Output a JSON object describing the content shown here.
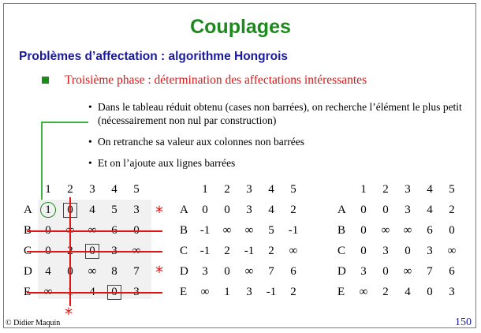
{
  "title": "Couplages",
  "subtitle": "Problèmes d’affectation : algorithme Hongrois",
  "phase": "Troisième phase : détermination des affectations intéressantes",
  "bullet_char": "•",
  "bullets": [
    "Dans le tableau réduit obtenu (cases non barrées), on recherche l’élément le plus petit (nécessairement non nul par construction)",
    "On retranche sa valeur aux colonnes non barrées",
    "Et on l’ajoute aux lignes barrées"
  ],
  "col_headers": [
    "1",
    "2",
    "3",
    "4",
    "5"
  ],
  "row_headers": [
    "A",
    "B",
    "C",
    "D",
    "E"
  ],
  "star": "*",
  "matrix1": [
    [
      "1",
      "0",
      "4",
      "5",
      "3"
    ],
    [
      "0",
      "∞",
      "∞",
      "6",
      "0"
    ],
    [
      "0",
      "2",
      "0",
      "3",
      "∞"
    ],
    [
      "4",
      "0",
      "∞",
      "8",
      "7"
    ],
    [
      "∞",
      "1",
      "4",
      "0",
      "3"
    ]
  ],
  "matrix2": [
    [
      "0",
      "0",
      "3",
      "4",
      "2"
    ],
    [
      "-1",
      "∞",
      "∞",
      "5",
      "-1"
    ],
    [
      "-1",
      "2",
      "-1",
      "2",
      "∞"
    ],
    [
      "3",
      "0",
      "∞",
      "7",
      "6"
    ],
    [
      "∞",
      "1",
      "3",
      "-1",
      "2"
    ]
  ],
  "matrix3": [
    [
      "0",
      "0",
      "3",
      "4",
      "2"
    ],
    [
      "0",
      "∞",
      "∞",
      "6",
      "0"
    ],
    [
      "0",
      "3",
      "0",
      "3",
      "∞"
    ],
    [
      "3",
      "0",
      "∞",
      "7",
      "6"
    ],
    [
      "∞",
      "2",
      "4",
      "0",
      "3"
    ]
  ],
  "footer_left": "© Didier Maquin",
  "page_number": "150",
  "colors": {
    "title": "#1d8a1d",
    "subtitle": "#1a1a9c",
    "phase": "#e01515",
    "strike": "#e01515"
  }
}
